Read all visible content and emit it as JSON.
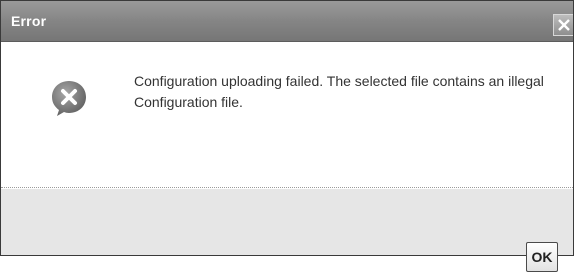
{
  "dialog": {
    "title": "Error",
    "close_icon": "close-icon",
    "status_icon": "error-icon",
    "message": "Configuration uploading failed. The selected file contains an illegal Configuration file.",
    "ok_label": "OK"
  },
  "colors": {
    "titlebar": "#858585",
    "footer": "#e6e6e6",
    "icon": "#7a7a7a",
    "text": "#333333"
  }
}
